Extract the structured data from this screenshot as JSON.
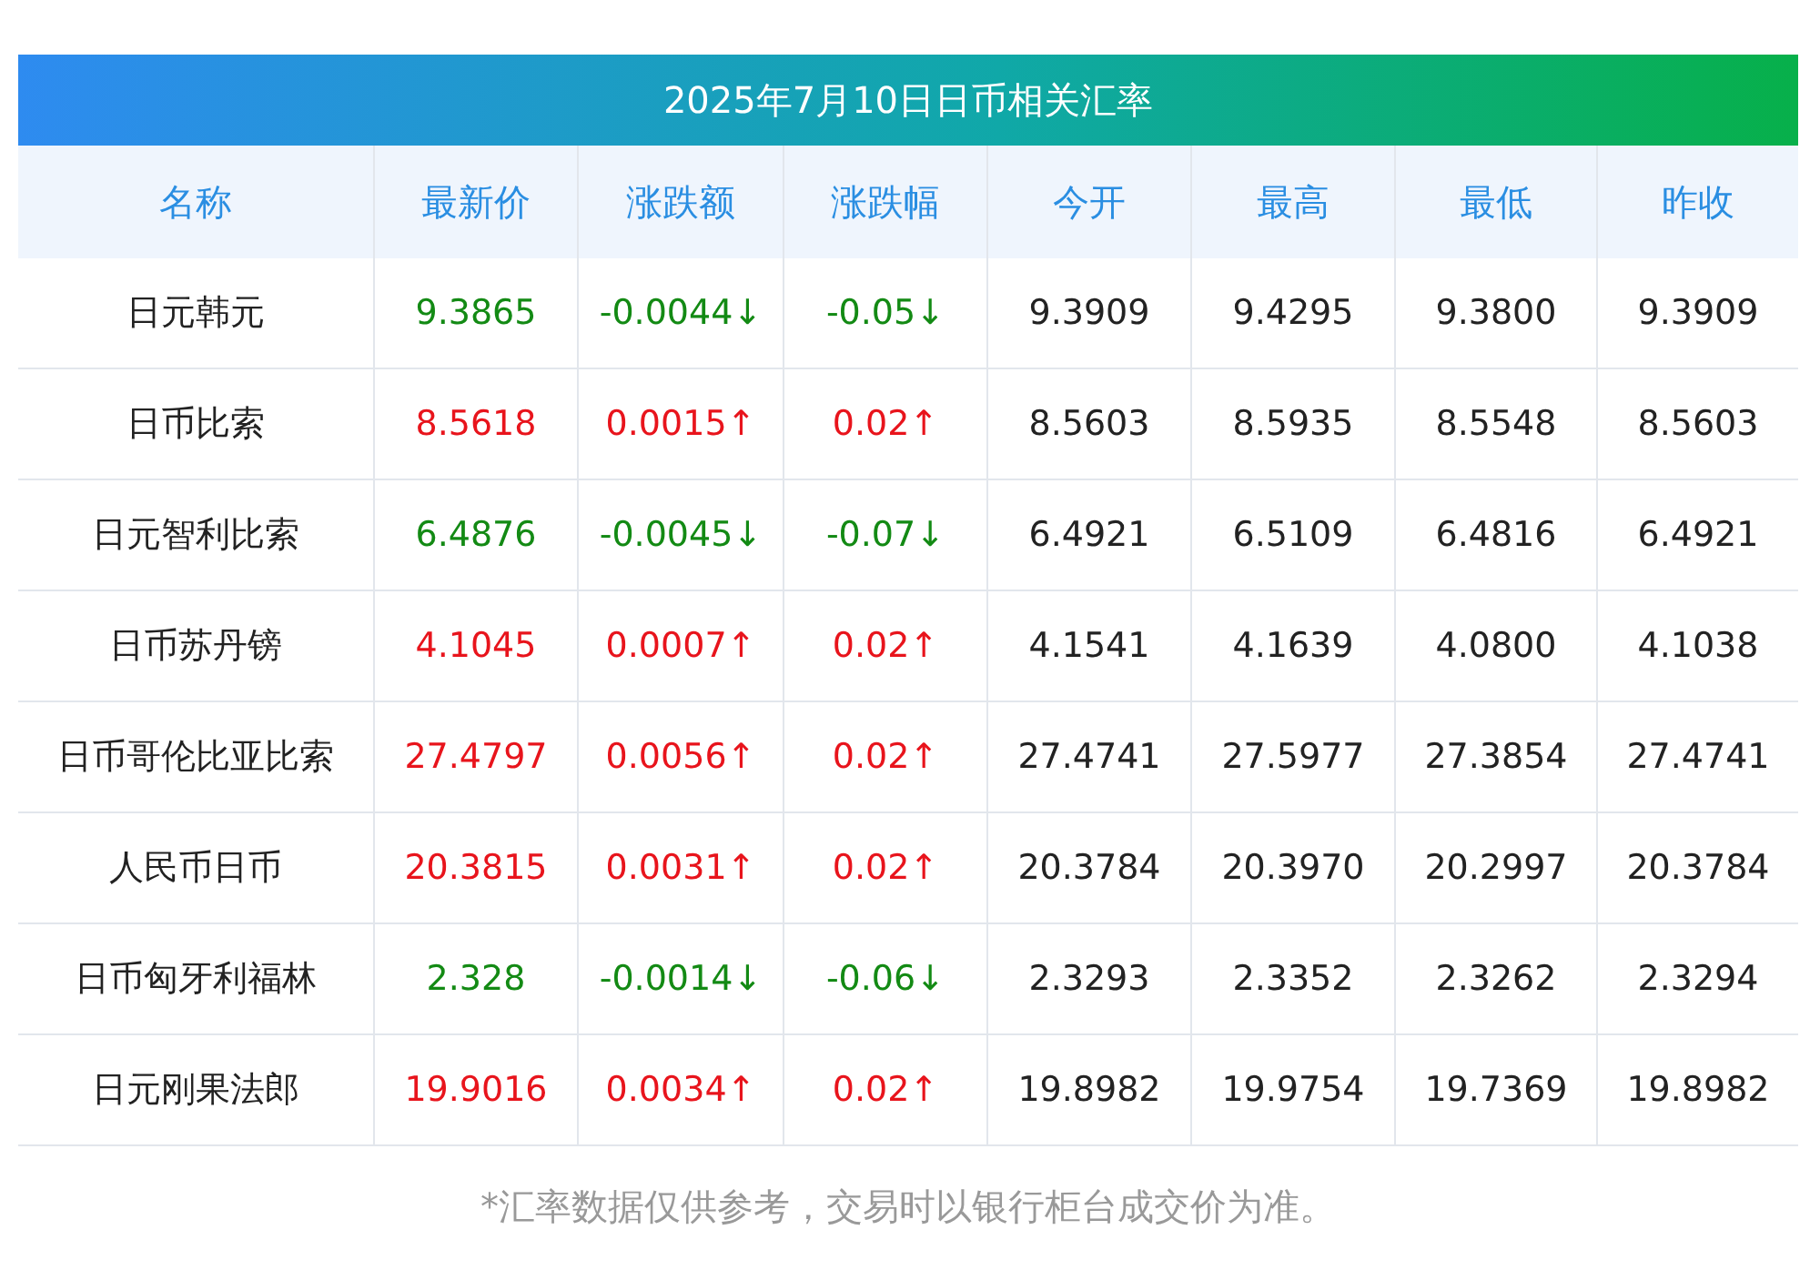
{
  "title": "2025年7月10日日币相关汇率",
  "columns": [
    "名称",
    "最新价",
    "涨跌额",
    "涨跌幅",
    "今开",
    "最高",
    "最低",
    "昨收"
  ],
  "rows": [
    {
      "name": "日元韩元",
      "rising": false,
      "price": "9.3865",
      "change": "-0.0044↓",
      "pct": "-0.05↓",
      "open": "9.3909",
      "high": "9.4295",
      "low": "9.3800",
      "prev": "9.3909"
    },
    {
      "name": "日币比索",
      "rising": true,
      "price": "8.5618",
      "change": "0.0015↑",
      "pct": "0.02↑",
      "open": "8.5603",
      "high": "8.5935",
      "low": "8.5548",
      "prev": "8.5603"
    },
    {
      "name": "日元智利比索",
      "rising": false,
      "price": "6.4876",
      "change": "-0.0045↓",
      "pct": "-0.07↓",
      "open": "6.4921",
      "high": "6.5109",
      "low": "6.4816",
      "prev": "6.4921"
    },
    {
      "name": "日币苏丹镑",
      "rising": true,
      "price": "4.1045",
      "change": "0.0007↑",
      "pct": "0.02↑",
      "open": "4.1541",
      "high": "4.1639",
      "low": "4.0800",
      "prev": "4.1038"
    },
    {
      "name": "日币哥伦比亚比索",
      "rising": true,
      "price": "27.4797",
      "change": "0.0056↑",
      "pct": "0.02↑",
      "open": "27.4741",
      "high": "27.5977",
      "low": "27.3854",
      "prev": "27.4741"
    },
    {
      "name": "人民币日币",
      "rising": true,
      "price": "20.3815",
      "change": "0.0031↑",
      "pct": "0.02↑",
      "open": "20.3784",
      "high": "20.3970",
      "low": "20.2997",
      "prev": "20.3784"
    },
    {
      "name": "日币匈牙利福林",
      "rising": false,
      "price": "2.328",
      "change": "-0.0014↓",
      "pct": "-0.06↓",
      "open": "2.3293",
      "high": "2.3352",
      "low": "2.3262",
      "prev": "2.3294"
    },
    {
      "name": "日元刚果法郎",
      "rising": true,
      "price": "19.9016",
      "change": "0.0034↑",
      "pct": "0.02↑",
      "open": "19.8982",
      "high": "19.9754",
      "low": "19.7369",
      "prev": "19.8982"
    }
  ],
  "footnote": "*汇率数据仅供参考，交易时以银行柜台成交价为准。"
}
